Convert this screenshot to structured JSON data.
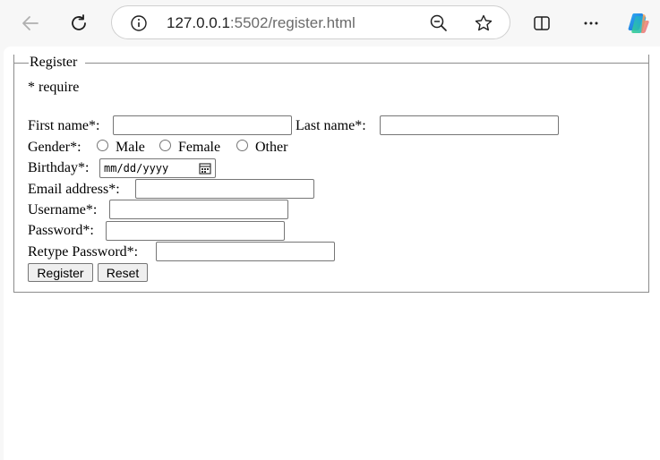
{
  "browser": {
    "url_host": "127.0.0.1",
    "url_rest": ":5502/register.html",
    "icons": [
      "back-arrow-icon",
      "refresh-icon",
      "info-icon",
      "zoom-out-icon",
      "favorite-star-icon",
      "split-screen-icon",
      "more-icon",
      "copilot-icon"
    ]
  },
  "form": {
    "legend": "Register",
    "require_note": "* require",
    "first_name_label": "First name*:",
    "last_name_label": "Last name*:",
    "gender_label": "Gender*:",
    "gender_options": [
      "Male",
      "Female",
      "Other"
    ],
    "birthday_label": "Birthday*:",
    "birthday_placeholder": "mm/dd/yyyy",
    "email_label": "Email address*:",
    "username_label": "Username*:",
    "password_label": "Password*:",
    "retype_password_label": "Retype Password*:",
    "register_button": "Register",
    "reset_button": "Reset"
  }
}
